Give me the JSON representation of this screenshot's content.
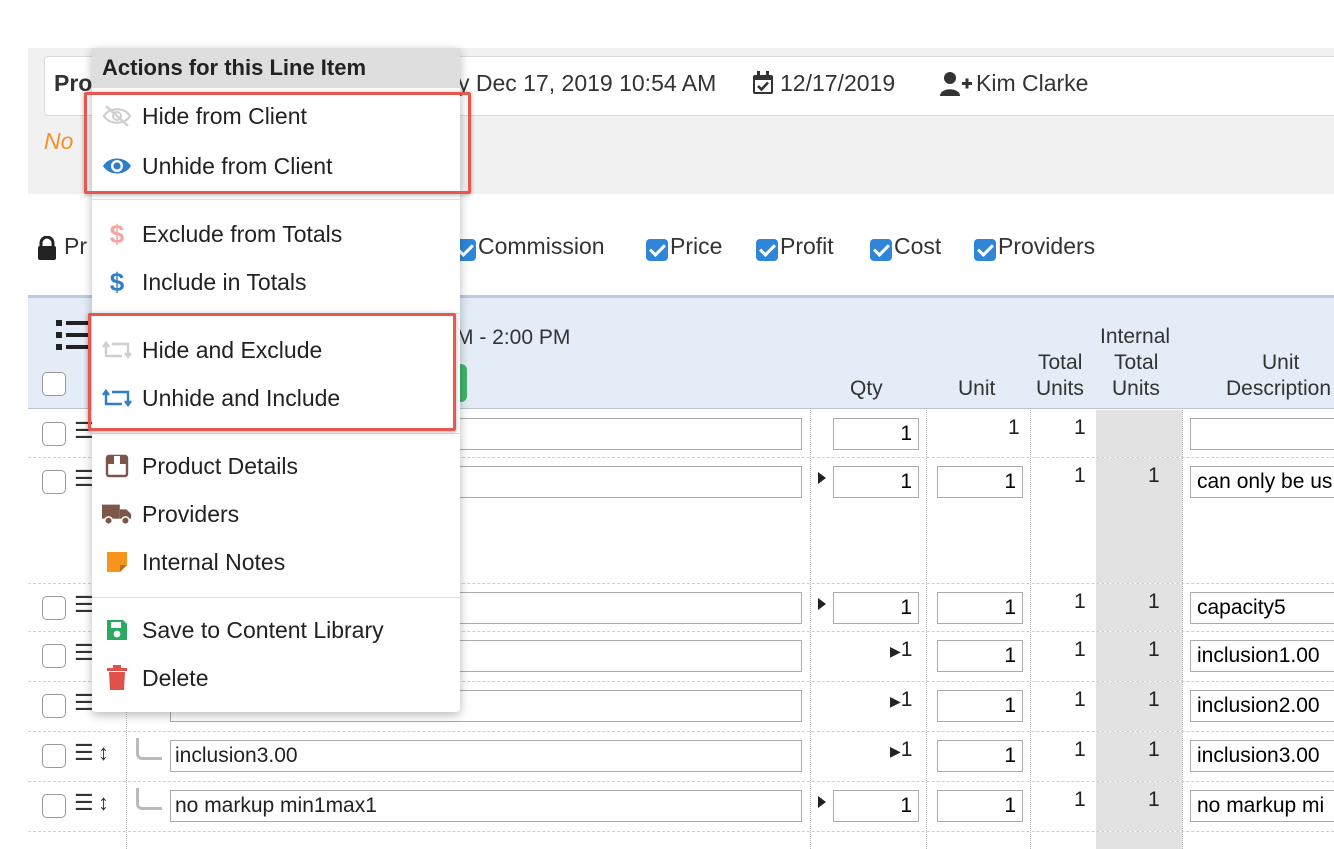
{
  "colors": {
    "accent_blue": "#2f86d6",
    "highlight_red": "#e8574f",
    "warning_orange": "#f29222",
    "header_bg": "#e4ecf7",
    "menu_header_bg": "#dedede"
  },
  "info_bar": {
    "truncated_label": "Pro",
    "created_text": "y Dec 17, 2019 10:54 AM",
    "date_text": "12/17/2019",
    "user_text": "Kim Clarke",
    "no_text": "No"
  },
  "visibility_toggles": {
    "lock_label": "Pr",
    "items": [
      "Commission",
      "Price",
      "Profit",
      "Cost",
      "Providers"
    ]
  },
  "table": {
    "header": {
      "time": "M - 2:00 PM",
      "qty": "Qty",
      "unit": "Unit",
      "total_units_1": "Total",
      "total_units_2": "Units",
      "internal_1": "Internal",
      "internal_2": "Total",
      "internal_3": "Units",
      "unit_desc_1": "Unit",
      "unit_desc_2": "Description"
    },
    "rows": [
      {
        "name": "",
        "qty": "1",
        "unit": "1",
        "total": "1",
        "internal": "",
        "desc": ""
      },
      {
        "name": "",
        "qty": "1",
        "unit": "1",
        "total": "1",
        "internal": "1",
        "desc": "can only be us"
      },
      {
        "name": "",
        "qty": "1",
        "unit": "1",
        "total": "1",
        "internal": "1",
        "desc": "capacity5"
      },
      {
        "name": "",
        "qty": "1",
        "unit": "1",
        "total": "1",
        "internal": "1",
        "desc": "inclusion1.00"
      },
      {
        "name": "",
        "qty": "1",
        "unit": "1",
        "total": "1",
        "internal": "1",
        "desc": "inclusion2.00"
      },
      {
        "name": "inclusion3.00",
        "qty": "1",
        "unit": "1",
        "total": "1",
        "internal": "1",
        "desc": "inclusion3.00"
      },
      {
        "name": "no markup min1max1",
        "qty": "1",
        "unit": "1",
        "total": "1",
        "internal": "1",
        "desc": "no markup mi"
      }
    ]
  },
  "context_menu": {
    "title": "Actions for this Line Item",
    "items": [
      {
        "label": "Hide from Client",
        "icon": "eye-slash-icon"
      },
      {
        "label": "Unhide from Client",
        "icon": "eye-icon"
      },
      {
        "label": "Exclude from Totals",
        "icon": "dollar-icon-faded"
      },
      {
        "label": "Include in Totals",
        "icon": "dollar-icon"
      },
      {
        "label": "Hide and Exclude",
        "icon": "retweet-icon-faded"
      },
      {
        "label": "Unhide and Include",
        "icon": "retweet-icon"
      },
      {
        "label": "Product Details",
        "icon": "box-icon"
      },
      {
        "label": "Providers",
        "icon": "truck-icon"
      },
      {
        "label": "Internal Notes",
        "icon": "sticky-note-icon"
      },
      {
        "label": "Save to Content Library",
        "icon": "save-icon"
      },
      {
        "label": "Delete",
        "icon": "trash-icon"
      }
    ]
  }
}
